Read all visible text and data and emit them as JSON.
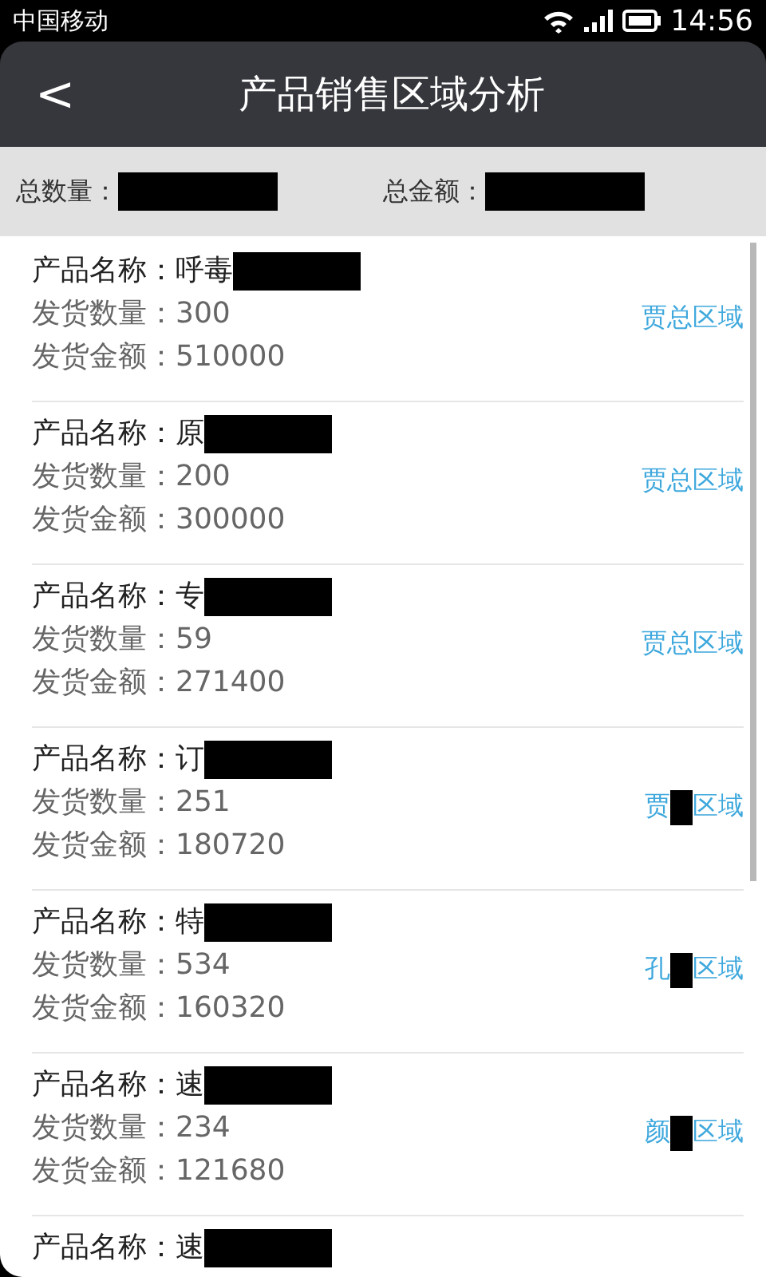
{
  "status_bar": {
    "carrier": "中国移动",
    "time": "14:56"
  },
  "header": {
    "back": "<",
    "title": "产品销售区域分析"
  },
  "summary": [
    {
      "label": "总数量：",
      "value": [
        {
          "kind": "redaction"
        }
      ]
    },
    {
      "label": "总金额：",
      "value": [
        {
          "kind": "redaction"
        }
      ]
    }
  ],
  "products": [
    {
      "name_label": "产品名称：",
      "name": [
        {
          "kind": "text",
          "text": "呼毒"
        },
        {
          "kind": "redaction"
        }
      ],
      "qty_label": "发货数量：",
      "qty": "300",
      "amount_label": "发货金额：",
      "amount": "510000",
      "region": [
        {
          "kind": "text",
          "text": "贾总区域"
        }
      ]
    },
    {
      "name_label": "产品名称：",
      "name": [
        {
          "kind": "text",
          "text": "原"
        },
        {
          "kind": "redaction"
        }
      ],
      "qty_label": "发货数量：",
      "qty": "200",
      "amount_label": "发货金额：",
      "amount": "300000",
      "region": [
        {
          "kind": "text",
          "text": "贾总区域"
        }
      ]
    },
    {
      "name_label": "产品名称：",
      "name": [
        {
          "kind": "text",
          "text": "专"
        },
        {
          "kind": "redaction"
        }
      ],
      "qty_label": "发货数量：",
      "qty": "59",
      "amount_label": "发货金额：",
      "amount": "271400",
      "region": [
        {
          "kind": "text",
          "text": "贾总区域"
        }
      ]
    },
    {
      "name_label": "产品名称：",
      "name": [
        {
          "kind": "text",
          "text": "订"
        },
        {
          "kind": "redaction"
        }
      ],
      "qty_label": "发货数量：",
      "qty": "251",
      "amount_label": "发货金额：",
      "amount": "180720",
      "region": [
        {
          "kind": "text",
          "text": "贾"
        },
        {
          "kind": "redaction"
        },
        {
          "kind": "text",
          "text": "区域"
        }
      ]
    },
    {
      "name_label": "产品名称：",
      "name": [
        {
          "kind": "text",
          "text": "特"
        },
        {
          "kind": "redaction"
        }
      ],
      "qty_label": "发货数量：",
      "qty": "534",
      "amount_label": "发货金额：",
      "amount": "160320",
      "region": [
        {
          "kind": "text",
          "text": "孔"
        },
        {
          "kind": "redaction"
        },
        {
          "kind": "text",
          "text": "区域"
        }
      ]
    },
    {
      "name_label": "产品名称：",
      "name": [
        {
          "kind": "text",
          "text": "速"
        },
        {
          "kind": "redaction"
        }
      ],
      "qty_label": "发货数量：",
      "qty": "234",
      "amount_label": "发货金额：",
      "amount": "121680",
      "region": [
        {
          "kind": "text",
          "text": "颜"
        },
        {
          "kind": "redaction"
        },
        {
          "kind": "text",
          "text": "区域"
        }
      ]
    },
    {
      "name_label": "产品名称：",
      "name": [
        {
          "kind": "text",
          "text": "速"
        },
        {
          "kind": "redaction"
        }
      ]
    }
  ]
}
